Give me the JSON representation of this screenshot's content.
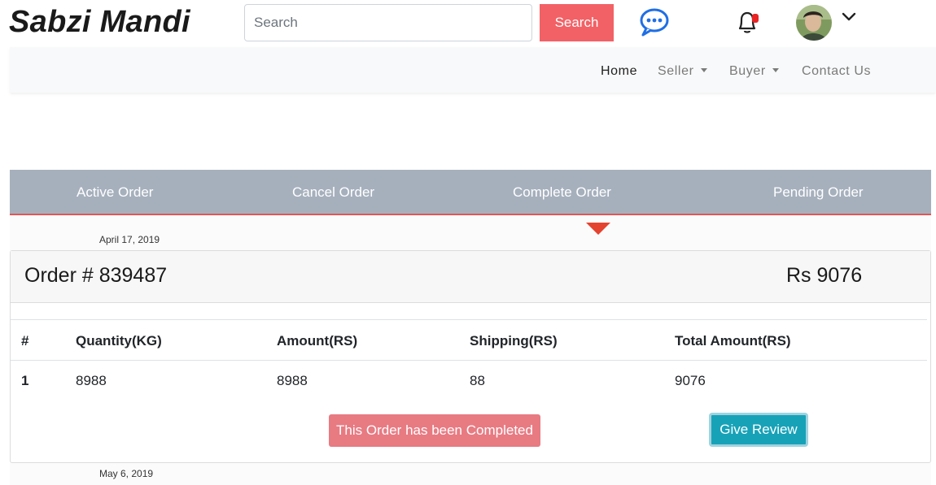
{
  "header": {
    "brand": "Sabzi Mandi",
    "search_placeholder": "Search",
    "search_button": "Search"
  },
  "nav": {
    "items": [
      {
        "label": "Home"
      },
      {
        "label": "Seller"
      },
      {
        "label": "Buyer"
      },
      {
        "label": "Contact Us"
      }
    ]
  },
  "tabs": [
    {
      "label": "Active Order"
    },
    {
      "label": "Cancel Order"
    },
    {
      "label": "Complete Order"
    },
    {
      "label": "Pending Order"
    }
  ],
  "orders": [
    {
      "date": "April 17, 2019",
      "title": "Order # 839487",
      "total": "Rs 9076",
      "columns": [
        "#",
        "Quantity(KG)",
        "Amount(RS)",
        "Shipping(RS)",
        "Total Amount(RS)"
      ],
      "rows": [
        [
          "1",
          "8988",
          "8988",
          "88",
          "9076"
        ]
      ],
      "status_label": "This Order has been Completed",
      "review_label": "Give Review"
    },
    {
      "date": "May 6, 2019"
    }
  ],
  "colors": {
    "accent": "#f26166",
    "tab_bar": "#a6b0bd",
    "pointer": "#e4432f",
    "review": "#17a2b8",
    "status": "#e87a82"
  },
  "icons": [
    "chat-bubble-icon",
    "bell-icon",
    "chevron-down-icon"
  ]
}
